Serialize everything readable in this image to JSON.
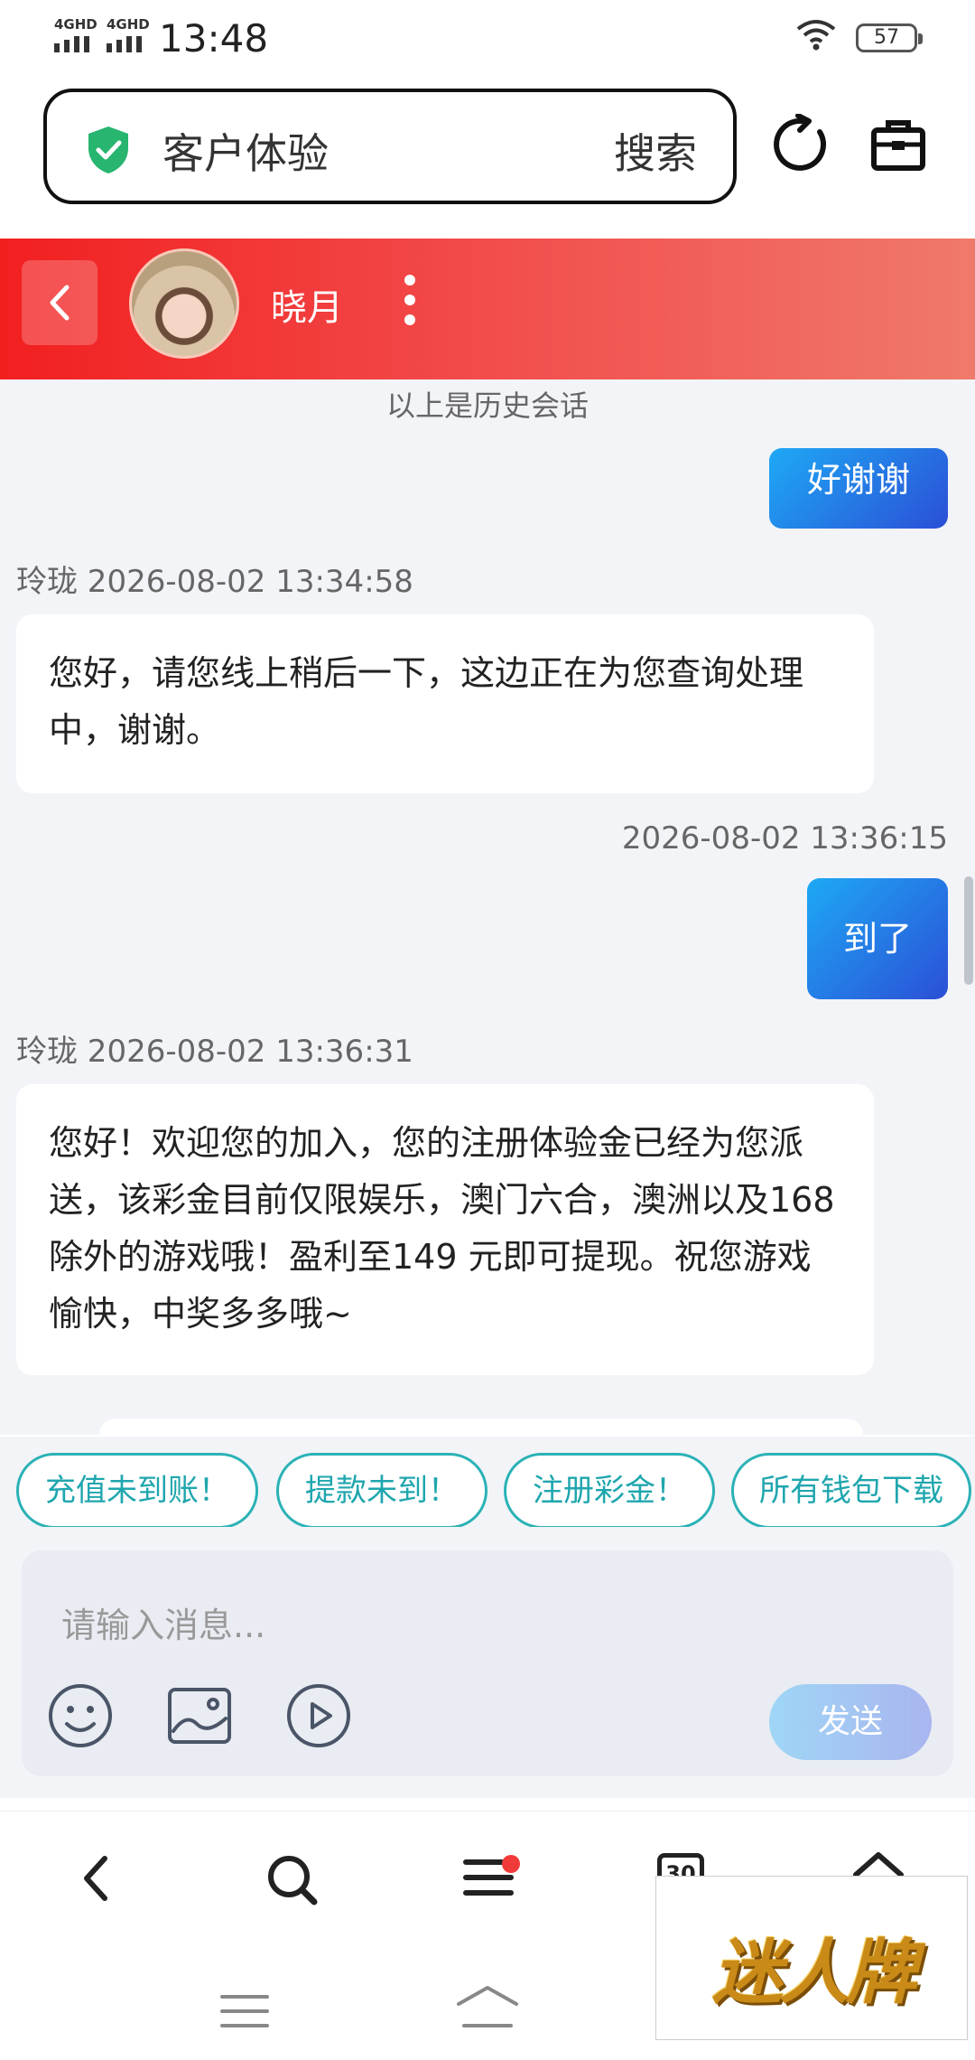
{
  "status_bar": {
    "signal1": "4GHD",
    "signal2": "4GHD",
    "time": "13:48",
    "battery": "57"
  },
  "browser": {
    "address_text": "客户体验",
    "search_label": "搜索",
    "icons": [
      "shield-check-icon",
      "reload-icon",
      "toolbox-icon"
    ]
  },
  "chat_header": {
    "agent_name": "晓月"
  },
  "chat": {
    "history_note": "以上是历史会话",
    "messages": [
      {
        "side": "right",
        "text": "好谢谢"
      },
      {
        "side": "left",
        "meta": "玲珑 2026-08-02 13:34:58",
        "text": "您好，请您线上稍后一下，这边正在为您查询处理中，谢谢。"
      },
      {
        "side": "right",
        "meta": "2026-08-02 13:36:15",
        "text": "到了"
      },
      {
        "side": "left",
        "meta": "玲珑 2026-08-02 13:36:31",
        "text": "您好！欢迎您的加入，您的注册体验金已经为您派送，该彩金目前仅限娱乐，澳门六合，澳洲以及168除外的游戏哦！盈利至149 元即可提现。祝您游戏愉快，中奖多多哦~"
      }
    ]
  },
  "quick_replies": [
    "充值未到账！",
    "提款未到！",
    "注册彩金！",
    "所有钱包下载"
  ],
  "composer": {
    "placeholder": "请输入消息...",
    "send_label": "发送"
  },
  "bottom_nav": {
    "tabs_count": "30"
  },
  "watermark": "迷人牌",
  "colors": {
    "header_red": "#f21f1f",
    "bubble_blue_start": "#1ea9f5",
    "bubble_blue_end": "#2b4fd6",
    "chip_teal": "#2bb2b6",
    "chat_bg": "#f2f4f8"
  }
}
